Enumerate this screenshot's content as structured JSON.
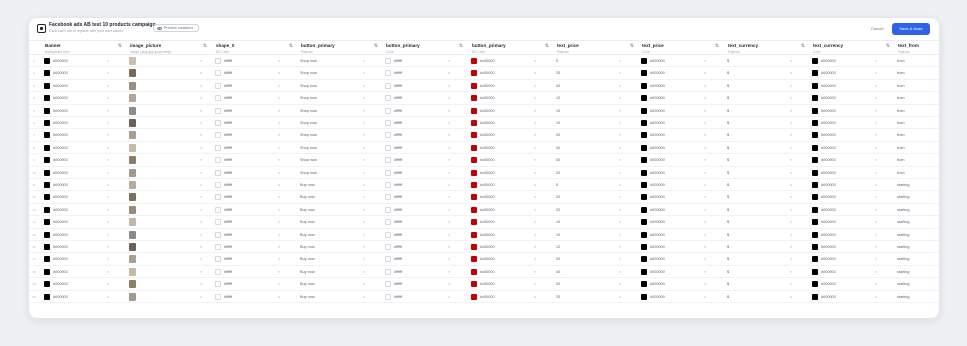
{
  "header": {
    "title": "Facebook ads AB test 10 products campaign",
    "subtitle": "Click each cell to replace with your own values",
    "preview_label": "Preview variations",
    "cancel_label": "Cancel",
    "save_label": "Save & close"
  },
  "columns": [
    {
      "name": "Banner",
      "type": "Background color"
    },
    {
      "name": "image_picture",
      "type": "Image (.png/.jpg/.jpeg/.webp)"
    },
    {
      "name": "shape_0",
      "type": "BG Color"
    },
    {
      "name": "button_primary",
      "type": "Payload"
    },
    {
      "name": "button_primary",
      "type": "Color"
    },
    {
      "name": "button_primary",
      "type": "BG Color"
    },
    {
      "name": "text_price",
      "type": "Payload"
    },
    {
      "name": "text_price",
      "type": "Color"
    },
    {
      "name": "text_currency",
      "type": "Payload"
    },
    {
      "name": "text_currency",
      "type": "Color"
    },
    {
      "name": "text_from",
      "type": "Payload"
    }
  ],
  "colors": {
    "black": "#000000",
    "white": "#ffffff",
    "red": "#c50000",
    "accent": "#2e63e8"
  },
  "rows": [
    {
      "num": "1",
      "banner": "#000000",
      "shape": "#ffffff",
      "btn_payload": "Shop now",
      "btn_color": "#ffffff",
      "btn_bg": "#c50000",
      "price": "5",
      "price_color": "#000000",
      "currency": "$",
      "currency_color": "#000000",
      "from": "from",
      "thumb": "#cdbfa8"
    },
    {
      "num": "2",
      "banner": "#000000",
      "shape": "#ffffff",
      "btn_payload": "Shop now",
      "btn_color": "#ffffff",
      "btn_bg": "#c50000",
      "price": "20",
      "price_color": "#000000",
      "currency": "$",
      "currency_color": "#000000",
      "from": "from",
      "thumb": "#7a6a55"
    },
    {
      "num": "3",
      "banner": "#000000",
      "shape": "#ffffff",
      "btn_payload": "Shop now",
      "btn_color": "#ffffff",
      "btn_bg": "#c50000",
      "price": "30",
      "price_color": "#000000",
      "currency": "$",
      "currency_color": "#000000",
      "from": "from",
      "thumb": "#9c8e7e"
    },
    {
      "num": "4",
      "banner": "#000000",
      "shape": "#ffffff",
      "btn_payload": "Shop now",
      "btn_color": "#ffffff",
      "btn_bg": "#c50000",
      "price": "10",
      "price_color": "#000000",
      "currency": "$",
      "currency_color": "#000000",
      "from": "from",
      "thumb": "#b5a793"
    },
    {
      "num": "5",
      "banner": "#000000",
      "shape": "#ffffff",
      "btn_payload": "Shop now",
      "btn_color": "#ffffff",
      "btn_bg": "#c50000",
      "price": "10",
      "price_color": "#000000",
      "currency": "$",
      "currency_color": "#000000",
      "from": "from",
      "thumb": "#8c8c8c"
    },
    {
      "num": "6",
      "banner": "#000000",
      "shape": "#ffffff",
      "btn_payload": "Shop now",
      "btn_color": "#ffffff",
      "btn_bg": "#c50000",
      "price": "10",
      "price_color": "#000000",
      "currency": "$",
      "currency_color": "#000000",
      "from": "from",
      "thumb": "#6e6258"
    },
    {
      "num": "7",
      "banner": "#000000",
      "shape": "#ffffff",
      "btn_payload": "Shop now",
      "btn_color": "#ffffff",
      "btn_bg": "#c50000",
      "price": "30",
      "price_color": "#000000",
      "currency": "$",
      "currency_color": "#000000",
      "from": "from",
      "thumb": "#a89d8f"
    },
    {
      "num": "8",
      "banner": "#000000",
      "shape": "#ffffff",
      "btn_payload": "Shop now",
      "btn_color": "#ffffff",
      "btn_bg": "#c50000",
      "price": "40",
      "price_color": "#000000",
      "currency": "$",
      "currency_color": "#000000",
      "from": "from",
      "thumb": "#c9b9a5"
    },
    {
      "num": "9",
      "banner": "#000000",
      "shape": "#ffffff",
      "btn_payload": "Shop now",
      "btn_color": "#ffffff",
      "btn_bg": "#c50000",
      "price": "30",
      "price_color": "#000000",
      "currency": "$",
      "currency_color": "#000000",
      "from": "from",
      "thumb": "#8e7c68"
    },
    {
      "num": "10",
      "banner": "#000000",
      "shape": "#ffffff",
      "btn_payload": "Shop now",
      "btn_color": "#ffffff",
      "btn_bg": "#c50000",
      "price": "20",
      "price_color": "#000000",
      "currency": "$",
      "currency_color": "#000000",
      "from": "from",
      "thumb": "#a09a90"
    },
    {
      "num": "11",
      "banner": "#000000",
      "shape": "#ffffff",
      "btn_payload": "Buy now",
      "btn_color": "#ffffff",
      "btn_bg": "#c50000",
      "price": "5",
      "price_color": "#000000",
      "currency": "$",
      "currency_color": "#000000",
      "from": "starting",
      "thumb": "#b8ab98"
    },
    {
      "num": "12",
      "banner": "#000000",
      "shape": "#ffffff",
      "btn_payload": "Buy now",
      "btn_color": "#ffffff",
      "btn_bg": "#c50000",
      "price": "20",
      "price_color": "#000000",
      "currency": "$",
      "currency_color": "#000000",
      "from": "starting",
      "thumb": "#7d6f60"
    },
    {
      "num": "13",
      "banner": "#000000",
      "shape": "#ffffff",
      "btn_payload": "Buy now",
      "btn_color": "#ffffff",
      "btn_bg": "#c50000",
      "price": "30",
      "price_color": "#000000",
      "currency": "$",
      "currency_color": "#000000",
      "from": "starting",
      "thumb": "#9a8b78"
    },
    {
      "num": "14",
      "banner": "#000000",
      "shape": "#ffffff",
      "btn_payload": "Buy now",
      "btn_color": "#ffffff",
      "btn_bg": "#c50000",
      "price": "10",
      "price_color": "#000000",
      "currency": "$",
      "currency_color": "#000000",
      "from": "starting",
      "thumb": "#c2b6a6"
    },
    {
      "num": "15",
      "banner": "#000000",
      "shape": "#ffffff",
      "btn_payload": "Buy now",
      "btn_color": "#ffffff",
      "btn_bg": "#c50000",
      "price": "10",
      "price_color": "#000000",
      "currency": "$",
      "currency_color": "#000000",
      "from": "starting",
      "thumb": "#8b8b8b"
    },
    {
      "num": "16",
      "banner": "#000000",
      "shape": "#ffffff",
      "btn_payload": "Buy now",
      "btn_color": "#ffffff",
      "btn_bg": "#c50000",
      "price": "12",
      "price_color": "#000000",
      "currency": "$",
      "currency_color": "#000000",
      "from": "starting",
      "thumb": "#6d625a"
    },
    {
      "num": "17",
      "banner": "#000000",
      "shape": "#ffffff",
      "btn_payload": "Buy now",
      "btn_color": "#ffffff",
      "btn_bg": "#c50000",
      "price": "30",
      "price_color": "#000000",
      "currency": "$",
      "currency_color": "#000000",
      "from": "starting",
      "thumb": "#a99e90"
    },
    {
      "num": "18",
      "banner": "#000000",
      "shape": "#ffffff",
      "btn_payload": "Buy now",
      "btn_color": "#ffffff",
      "btn_bg": "#c50000",
      "price": "40",
      "price_color": "#000000",
      "currency": "$",
      "currency_color": "#000000",
      "from": "starting",
      "thumb": "#c7b8a4"
    },
    {
      "num": "19",
      "banner": "#000000",
      "shape": "#ffffff",
      "btn_payload": "Buy now",
      "btn_color": "#ffffff",
      "btn_bg": "#c50000",
      "price": "30",
      "price_color": "#000000",
      "currency": "$",
      "currency_color": "#000000",
      "from": "starting",
      "thumb": "#8f7d6a"
    },
    {
      "num": "20",
      "banner": "#000000",
      "shape": "#ffffff",
      "btn_payload": "Buy now",
      "btn_color": "#ffffff",
      "btn_bg": "#c50000",
      "price": "20",
      "price_color": "#000000",
      "currency": "$",
      "currency_color": "#000000",
      "from": "starting",
      "thumb": "#9f998f"
    }
  ]
}
